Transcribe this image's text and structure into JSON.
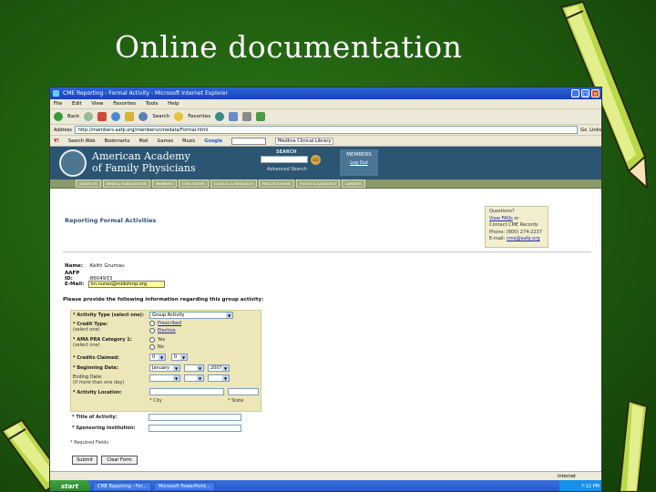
{
  "slide": {
    "title": "Online documentation"
  },
  "browser": {
    "window_title": "CME Reporting - Formal Activity - Microsoft Internet Explorer",
    "menu": [
      "File",
      "Edit",
      "View",
      "Favorites",
      "Tools",
      "Help"
    ],
    "toolbar": {
      "back": "Back",
      "search": "Search",
      "favorites": "Favorites"
    },
    "address_label": "Address",
    "address": "http://members.aafp.org/members/cmedata/Formal.html",
    "go_label": "Go",
    "links_label": "Links",
    "links": [
      "Y!",
      "Search Web",
      "Bookmarks",
      "Mail",
      "Games",
      "Music"
    ],
    "google_label": "Google",
    "medline_label": "Medline Clinical Library",
    "status_left": "",
    "status_right": "Internet"
  },
  "site": {
    "org_line1": "American Academy",
    "org_line2": "of Family Physicians",
    "search_label": "SEARCH",
    "go_button": "GO",
    "advanced_search": "Advanced Search",
    "members_label": "MEMBERS",
    "logout_label": "Log Out",
    "nav": [
      "ABOUT US",
      "NEWS & PUBLICATIONS",
      "MEMBERS",
      "CME CENTER",
      "CLINICAL & RESEARCH",
      "PRACTICE MGMT",
      "POLICY & ADVOCACY",
      "CAREERS"
    ]
  },
  "page": {
    "heading": "Reporting Formal Activities",
    "questions": {
      "title": "Questions?",
      "faq_link": "View FAQs",
      "faq_suffix": " or",
      "contact": "Contact CME Records",
      "phone": "Phone: (800) 274-2237",
      "email_label": "E-mail: ",
      "email_link": "cme@aafp.org"
    },
    "name_label": "Name:",
    "name_value": "Keith Grumau",
    "aafp_label": "AAFP ID:",
    "aafp_value": "8604933",
    "email_label": "E-Mail:",
    "email_value": "kn.nunez@midshrop.org",
    "instructions": "Please provide the following information regarding this group activity:"
  },
  "form": {
    "activity_type_label": "* Activity Type (select one):",
    "activity_type_value": "Group Activity",
    "credit_type_label": "* Credit Type:",
    "credit_type_sub": "(select one)",
    "credit_type_options": [
      "Prescribed",
      "Elective"
    ],
    "ama_label": "* AMA PRA Category 1:",
    "ama_sub": "(select one)",
    "ama_options": [
      "Yes",
      "No"
    ],
    "credits_label": "* Credits Claimed:",
    "credits_whole": "0",
    "credits_fraction": "0",
    "begin_label": "* Beginning Date:",
    "begin_month": "January",
    "begin_year": "2007",
    "end_label": "Ending Date:",
    "end_sub": "(if more than one day)",
    "location_label": "* Activity Location:",
    "city_label": "* City",
    "state_label": "* State",
    "title_label": "* Title of Activity:",
    "sponsor_label": "* Sponsoring Institution:",
    "required_note": "* Required Fields",
    "submit": "Submit",
    "clear": "Clear Form"
  },
  "taskbar": {
    "start": "start",
    "tasks": [
      "CME Reporting - For...",
      "Microsoft PowerPoint..."
    ],
    "clock": "7:12 PM"
  },
  "colors": {
    "slide_green": "#1f5a10",
    "header_blue": "#2b5572",
    "nav_olive": "#8b9a6a",
    "form_tan": "#ece6b8",
    "heading_blue": "#2a4f7c",
    "email_yellow": "#ffff99"
  }
}
